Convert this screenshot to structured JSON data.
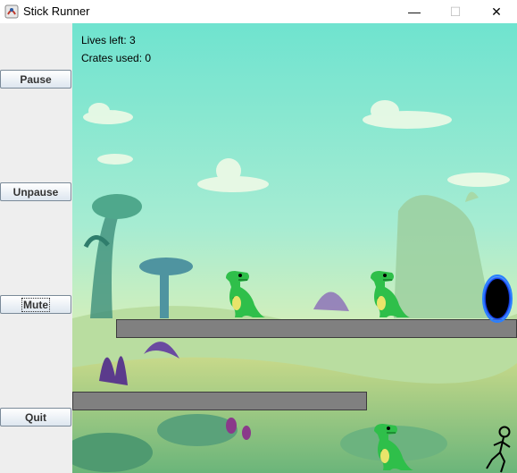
{
  "window": {
    "title": "Stick Runner",
    "icon": "java-app-icon",
    "controls": [
      "minimize-icon",
      "maximize-icon",
      "close-icon"
    ]
  },
  "sidebar": {
    "buttons": [
      {
        "label": "Pause"
      },
      {
        "label": "Unpause"
      },
      {
        "label": "Mute"
      },
      {
        "label": "Quit"
      }
    ]
  },
  "hud": {
    "lives": "Lives left: 3",
    "crates": "Crates used: 0"
  },
  "colors": {
    "sky": "#8fe8d0",
    "ledge": "#808080",
    "dino": "#2fbf4a",
    "portal_glow": "#2a7fff"
  }
}
